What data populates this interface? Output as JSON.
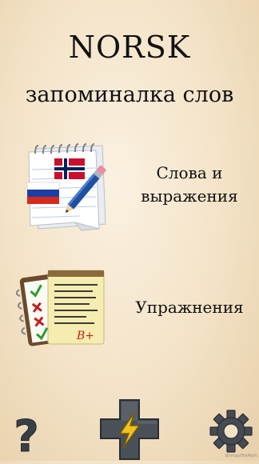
{
  "header": {
    "title": "NORSK",
    "subtitle": "запоминалка слов"
  },
  "menu": {
    "words": {
      "label": "Слова и выражения",
      "icon": "notepad-flags-pencil-icon"
    },
    "exercises": {
      "label": "Упражнения",
      "icon": "clipboard-checklist-icon",
      "grade": "B+"
    }
  },
  "bottom_bar": {
    "help": {
      "glyph": "?",
      "icon": "question-mark-icon"
    },
    "add": {
      "icon": "plus-lightning-icon"
    },
    "settings": {
      "icon": "gear-icon"
    }
  },
  "watermark": "Bitmap/FileMark",
  "colors": {
    "background": "#f3e2c6",
    "text": "#111111",
    "icon_dark": "#3a3f45",
    "lightning": "#f0c020",
    "flag_red": "#c8102e",
    "flag_blue": "#00205b",
    "grade_red": "#c02020"
  }
}
